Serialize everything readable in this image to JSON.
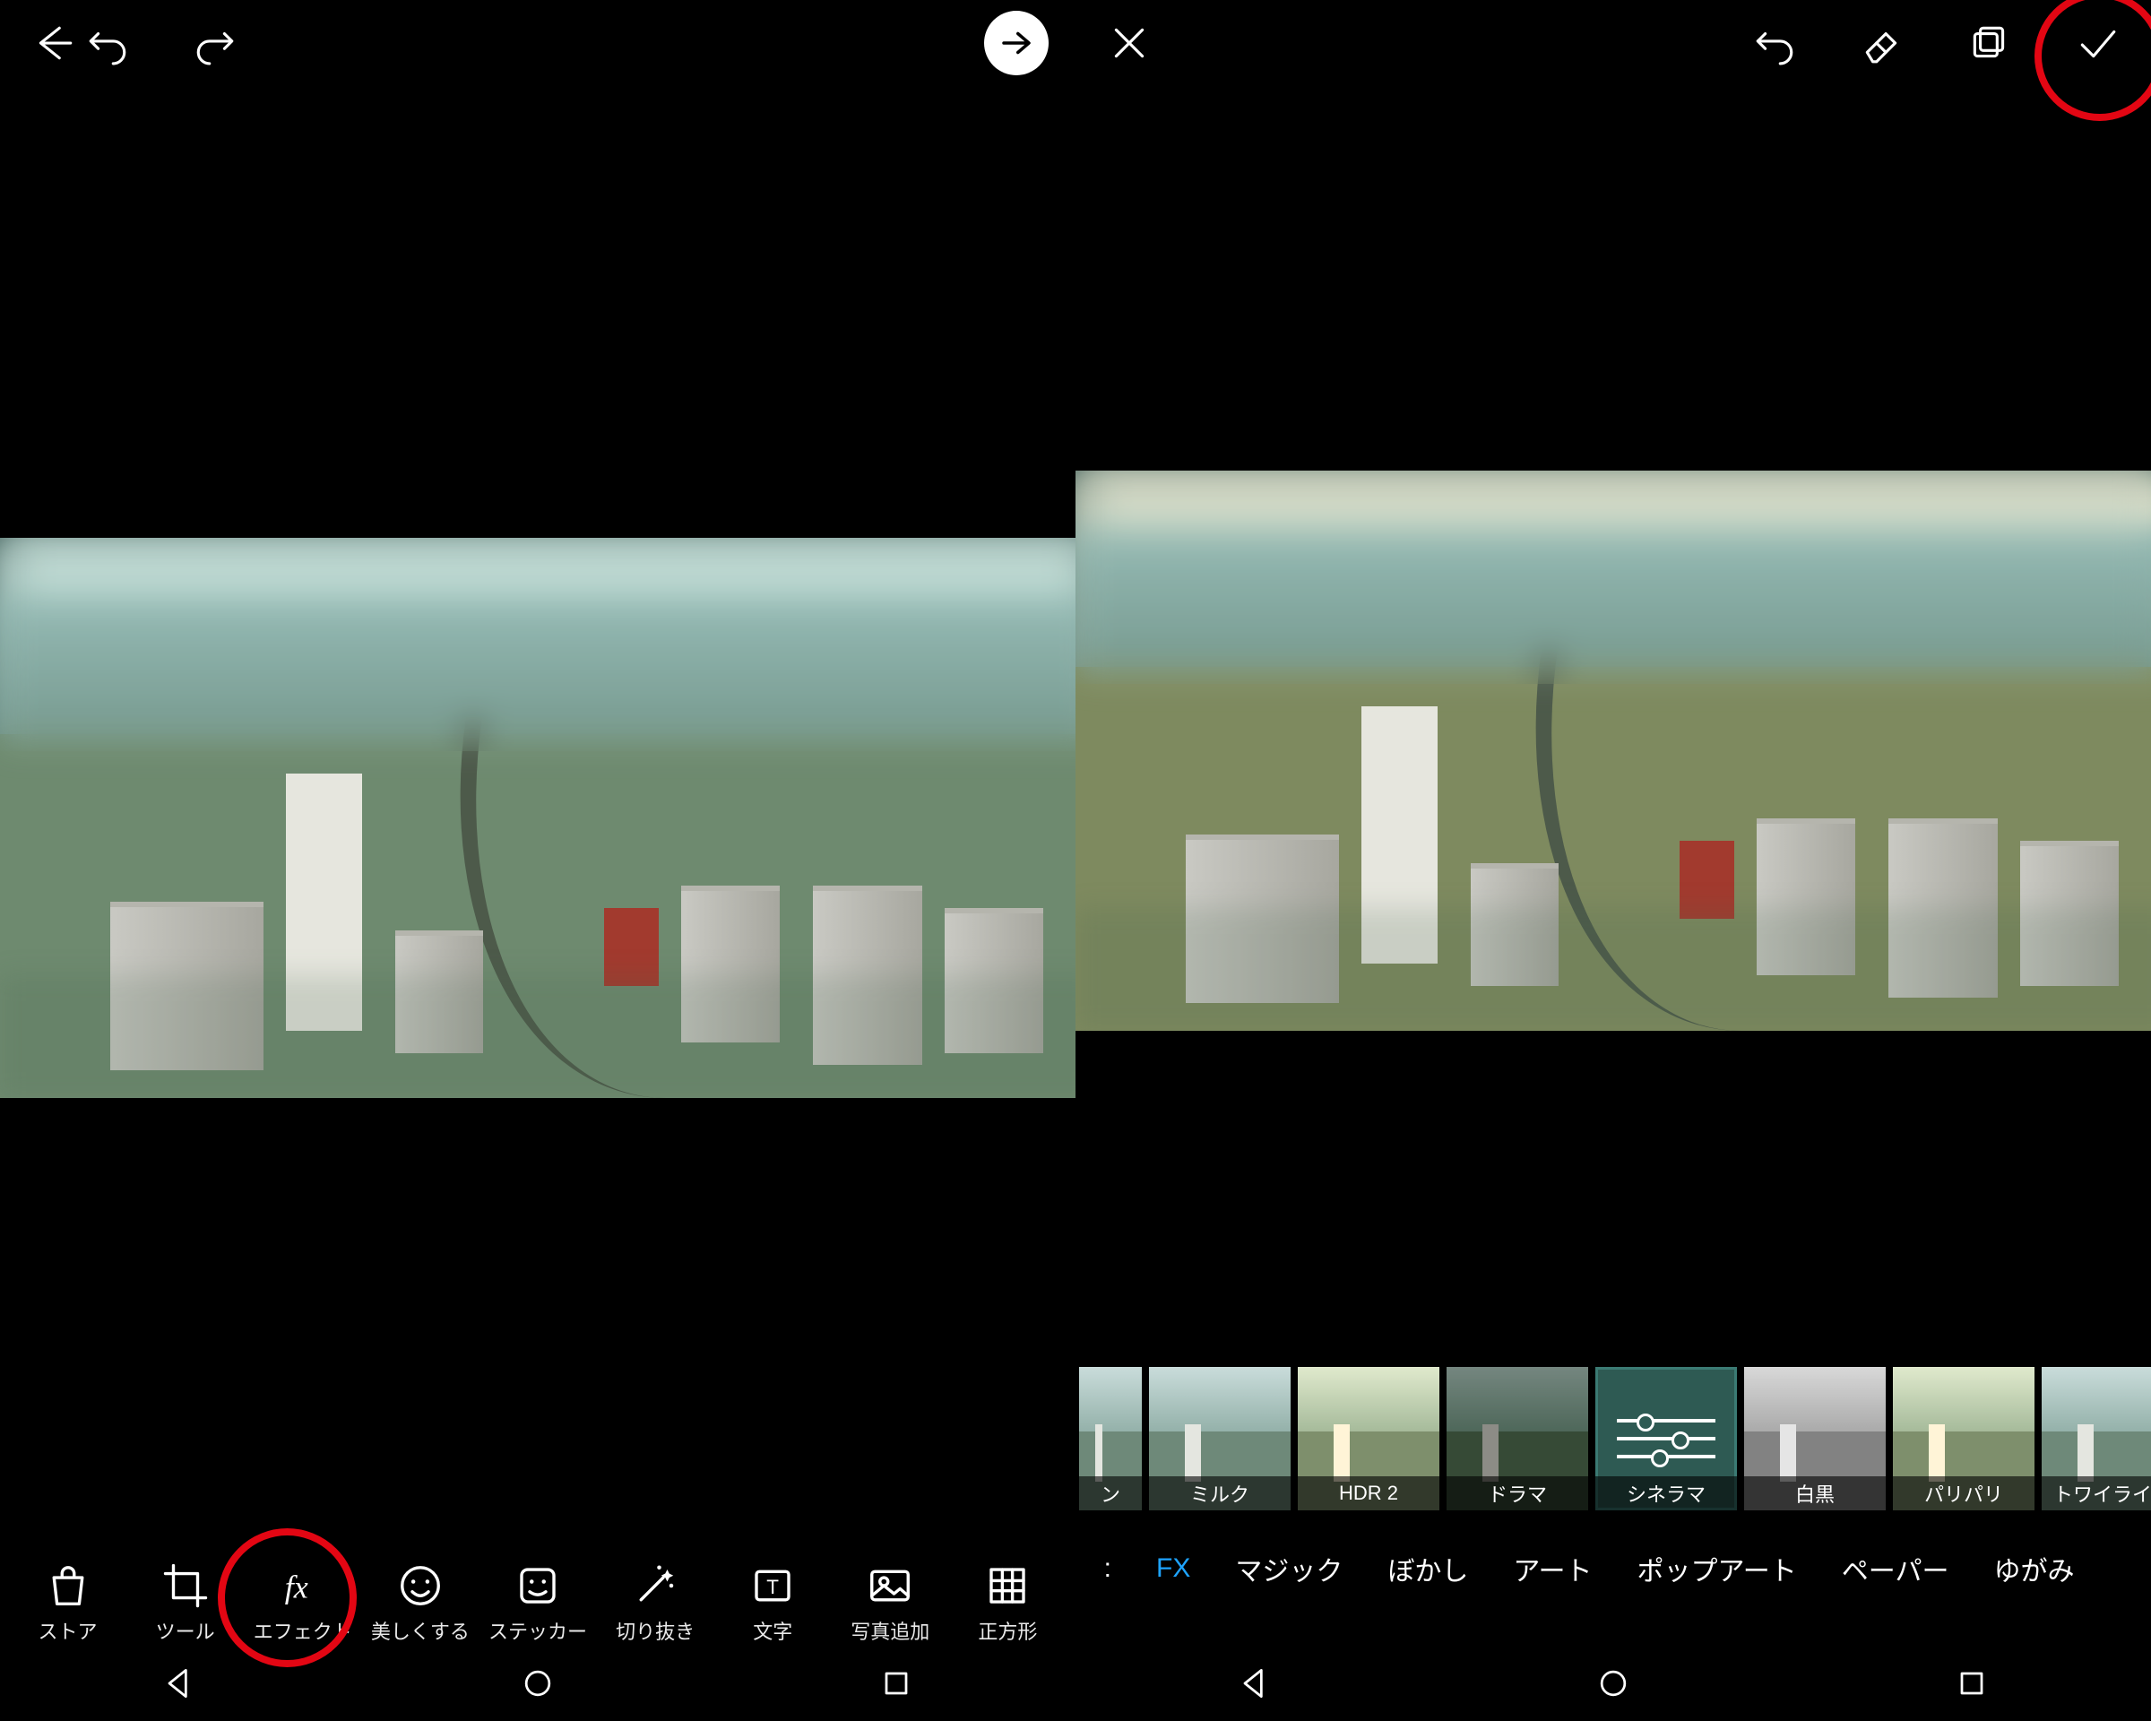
{
  "left": {
    "toolbar": {
      "back": "back-icon",
      "undo": "undo-icon",
      "redo": "redo-icon",
      "proceed": "proceed-arrow-icon"
    },
    "bottom_tools": [
      {
        "key": "store",
        "label": "ストア"
      },
      {
        "key": "tool",
        "label": "ツール"
      },
      {
        "key": "effect",
        "label": "エフェクト"
      },
      {
        "key": "beauty",
        "label": "美しくする"
      },
      {
        "key": "sticker",
        "label": "ステッカー"
      },
      {
        "key": "cutout",
        "label": "切り抜き"
      },
      {
        "key": "text",
        "label": "文字"
      },
      {
        "key": "addphoto",
        "label": "写真追加"
      },
      {
        "key": "square",
        "label": "正方形"
      }
    ]
  },
  "right": {
    "toolbar": {
      "close": "close-icon",
      "undo": "undo-icon",
      "eraser": "eraser-icon",
      "layers": "layers-icon",
      "apply": "checkmark-icon"
    },
    "filters": [
      {
        "key": "prev-cut",
        "label": "ン",
        "style": "cool",
        "partial": true
      },
      {
        "key": "milk",
        "label": "ミルク",
        "style": "cool"
      },
      {
        "key": "hdr2",
        "label": "HDR 2",
        "style": "warm"
      },
      {
        "key": "drama",
        "label": "ドラマ",
        "style": "dark"
      },
      {
        "key": "cinerama",
        "label": "シネラマ",
        "style": "selected",
        "selected": true
      },
      {
        "key": "bw",
        "label": "白黒",
        "style": "bw"
      },
      {
        "key": "crisp",
        "label": "パリパリ",
        "style": "warm"
      },
      {
        "key": "twilight",
        "label": "トワイライト",
        "style": "cool"
      }
    ],
    "categories": [
      {
        "key": "fx-cut",
        "label": ":",
        "partial": true
      },
      {
        "key": "fx",
        "label": "FX",
        "active": true
      },
      {
        "key": "magic",
        "label": "マジック"
      },
      {
        "key": "blur",
        "label": "ぼかし"
      },
      {
        "key": "art",
        "label": "アート"
      },
      {
        "key": "popart",
        "label": "ポップアート"
      },
      {
        "key": "paper",
        "label": "ペーパー"
      },
      {
        "key": "distort",
        "label": "ゆがみ"
      }
    ]
  },
  "nav": {
    "back": "nav-back-icon",
    "home": "nav-home-icon",
    "recent": "nav-recent-icon"
  },
  "colors": {
    "accent": "#1ea4ff",
    "highlight": "#e30613"
  }
}
